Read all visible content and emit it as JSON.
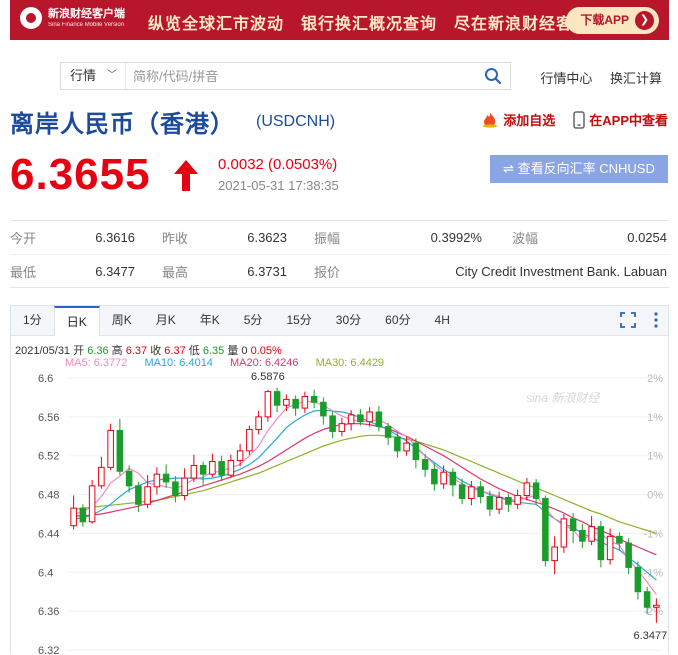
{
  "banner": {
    "logo_text": "新浪财经客户端",
    "logo_sub": "Sina Finance Mobile Version",
    "slogan": "纵览全球汇市波动　银行换汇概况查询　尽在新浪财经客户端",
    "download": "下载APP"
  },
  "search": {
    "category": "行情",
    "placeholder": "简称/代码/拼音",
    "links": [
      "行情中心",
      "换汇计算"
    ]
  },
  "header": {
    "title": "离岸人民币（香港）",
    "code": "(USDCNH)",
    "add_watch": "添加自选",
    "view_in_app": "在APP中查看"
  },
  "quote": {
    "price": "6.3655",
    "change": "0.0032 (0.0503%)",
    "time": "2021-05-31 17:38:35",
    "reverse_btn": "⇌ 查看反向汇率 CNHUSD"
  },
  "stats": {
    "row1": [
      {
        "label": "今开",
        "value": "6.3616"
      },
      {
        "label": "昨收",
        "value": "6.3623"
      },
      {
        "label": "振幅",
        "value": "0.3992%"
      },
      {
        "label": "波幅",
        "value": "0.0254"
      }
    ],
    "row2": [
      {
        "label": "最低",
        "value": "6.3477"
      },
      {
        "label": "最高",
        "value": "6.3731"
      },
      {
        "label": "报价",
        "value": "City Credit Investment Bank. Labuan"
      }
    ]
  },
  "tabs": [
    "1分",
    "日K",
    "周K",
    "月K",
    "年K",
    "5分",
    "15分",
    "30分",
    "60分",
    "4H"
  ],
  "active_tab": "日K",
  "kline_info": {
    "date": "2021/05/31",
    "open_label": "开",
    "open": "6.36",
    "high_label": "高",
    "high": "6.37",
    "close_label": "收",
    "close": "6.37",
    "low_label": "低",
    "low": "6.35",
    "vol_label": "量",
    "vol": "0",
    "pct": "0.05%"
  },
  "ma": [
    {
      "label": "MA5: 6.3772",
      "color": "#f08cc0"
    },
    {
      "label": "MA10: 6.4014",
      "color": "#2aa8d8"
    },
    {
      "label": "MA20: 6.4246",
      "color": "#e0356d"
    },
    {
      "label": "MA30: 6.4429",
      "color": "#8db227"
    }
  ],
  "watermark": "sina 新浪财经",
  "chart_data": {
    "type": "candlestick",
    "ylim": [
      6.32,
      6.6
    ],
    "y_ticks": [
      "6.6",
      "6.56",
      "6.52",
      "6.48",
      "6.44",
      "6.4",
      "6.36",
      "6.32"
    ],
    "right_ticks": [
      "2%",
      "1%",
      "1%",
      "0%",
      "-1%",
      "-1%",
      "-2%"
    ],
    "max_label": "6.5876",
    "min_label": "6.3477",
    "up_color": "#e60012",
    "down_color": "#1a9d2a",
    "candles": [
      [
        6.448,
        6.466,
        6.479,
        6.444
      ],
      [
        6.466,
        6.452,
        6.47,
        6.447
      ],
      [
        6.452,
        6.489,
        6.495,
        6.45
      ],
      [
        6.489,
        6.508,
        6.519,
        6.486
      ],
      [
        6.508,
        6.546,
        6.553,
        6.505
      ],
      [
        6.546,
        6.504,
        6.558,
        6.5
      ],
      [
        6.504,
        6.489,
        6.51,
        6.482
      ],
      [
        6.489,
        6.47,
        6.493,
        6.462
      ],
      [
        6.47,
        6.488,
        6.5,
        6.466
      ],
      [
        6.488,
        6.501,
        6.508,
        6.48
      ],
      [
        6.501,
        6.493,
        6.511,
        6.487
      ],
      [
        6.493,
        6.479,
        6.499,
        6.472
      ],
      [
        6.479,
        6.497,
        6.507,
        6.474
      ],
      [
        6.497,
        6.51,
        6.521,
        6.493
      ],
      [
        6.51,
        6.501,
        6.514,
        6.49
      ],
      [
        6.501,
        6.514,
        6.522,
        6.498
      ],
      [
        6.514,
        6.5,
        6.52,
        6.494
      ],
      [
        6.5,
        6.515,
        6.521,
        6.497
      ],
      [
        6.515,
        6.525,
        6.532,
        6.509
      ],
      [
        6.525,
        6.547,
        6.551,
        6.521
      ],
      [
        6.547,
        6.56,
        6.566,
        6.542
      ],
      [
        6.56,
        6.586,
        6.588,
        6.555
      ],
      [
        6.586,
        6.572,
        6.59,
        6.565
      ],
      [
        6.572,
        6.578,
        6.583,
        6.566
      ],
      [
        6.578,
        6.569,
        6.582,
        6.561
      ],
      [
        6.569,
        6.581,
        6.586,
        6.564
      ],
      [
        6.581,
        6.575,
        6.588,
        6.569
      ],
      [
        6.575,
        6.561,
        6.58,
        6.552
      ],
      [
        6.561,
        6.545,
        6.566,
        6.538
      ],
      [
        6.545,
        6.553,
        6.559,
        6.54
      ],
      [
        6.553,
        6.562,
        6.567,
        6.546
      ],
      [
        6.562,
        6.555,
        6.568,
        6.551
      ],
      [
        6.555,
        6.565,
        6.57,
        6.55
      ],
      [
        6.565,
        6.55,
        6.571,
        6.545
      ],
      [
        6.55,
        6.539,
        6.554,
        6.531
      ],
      [
        6.539,
        6.525,
        6.545,
        6.518
      ],
      [
        6.525,
        6.533,
        6.54,
        6.52
      ],
      [
        6.533,
        6.516,
        6.538,
        6.507
      ],
      [
        6.516,
        6.506,
        6.522,
        6.498
      ],
      [
        6.506,
        6.491,
        6.512,
        6.484
      ],
      [
        6.491,
        6.503,
        6.51,
        6.486
      ],
      [
        6.503,
        6.49,
        6.507,
        6.478
      ],
      [
        6.49,
        6.476,
        6.496,
        6.47
      ],
      [
        6.476,
        6.488,
        6.494,
        6.469
      ],
      [
        6.488,
        6.478,
        6.494,
        6.471
      ],
      [
        6.478,
        6.465,
        6.484,
        6.458
      ],
      [
        6.465,
        6.477,
        6.483,
        6.46
      ],
      [
        6.477,
        6.47,
        6.481,
        6.462
      ],
      [
        6.47,
        6.479,
        6.485,
        6.465
      ],
      [
        6.479,
        6.492,
        6.497,
        6.474
      ],
      [
        6.492,
        6.476,
        6.496,
        6.469
      ],
      [
        6.476,
        6.412,
        6.479,
        6.406
      ],
      [
        6.412,
        6.426,
        6.437,
        6.398
      ],
      [
        6.426,
        6.455,
        6.46,
        6.42
      ],
      [
        6.455,
        6.443,
        6.461,
        6.43
      ],
      [
        6.443,
        6.432,
        6.45,
        6.425
      ],
      [
        6.432,
        6.447,
        6.458,
        6.428
      ],
      [
        6.447,
        6.413,
        6.453,
        6.405
      ],
      [
        6.413,
        6.437,
        6.445,
        6.408
      ],
      [
        6.437,
        6.43,
        6.441,
        6.422
      ],
      [
        6.43,
        6.405,
        6.435,
        6.398
      ],
      [
        6.405,
        6.38,
        6.411,
        6.372
      ],
      [
        6.38,
        6.364,
        6.385,
        6.357
      ],
      [
        6.364,
        6.366,
        6.373,
        6.348
      ]
    ],
    "ma5": [
      6.46,
      6.462,
      6.468,
      6.478,
      6.492,
      6.499,
      6.507,
      6.502,
      6.492,
      6.49,
      6.488,
      6.486,
      6.49,
      6.496,
      6.498,
      6.503,
      6.504,
      6.508,
      6.511,
      6.52,
      6.53,
      6.546,
      6.558,
      6.569,
      6.573,
      6.576,
      6.575,
      6.572,
      6.566,
      6.561,
      6.557,
      6.555,
      6.556,
      6.557,
      6.552,
      6.545,
      6.54,
      6.53,
      6.52,
      6.511,
      6.503,
      6.497,
      6.491,
      6.486,
      6.484,
      6.481,
      6.478,
      6.475,
      6.474,
      6.477,
      6.479,
      6.466,
      6.455,
      6.448,
      6.444,
      6.432,
      6.441,
      6.44,
      6.432,
      6.428,
      6.413,
      6.402,
      6.39,
      6.377
    ],
    "ma10": [
      6.455,
      6.456,
      6.459,
      6.464,
      6.47,
      6.478,
      6.485,
      6.489,
      6.493,
      6.495,
      6.496,
      6.497,
      6.497,
      6.497,
      6.496,
      6.497,
      6.499,
      6.502,
      6.506,
      6.511,
      6.518,
      6.528,
      6.538,
      6.549,
      6.556,
      6.562,
      6.566,
      6.567,
      6.566,
      6.565,
      6.563,
      6.559,
      6.555,
      6.551,
      6.547,
      6.541,
      6.535,
      6.528,
      6.52,
      6.513,
      6.506,
      6.5,
      6.494,
      6.489,
      6.484,
      6.48,
      6.477,
      6.474,
      6.472,
      6.471,
      6.47,
      6.462,
      6.455,
      6.45,
      6.446,
      6.44,
      6.436,
      6.431,
      6.427,
      6.423,
      6.415,
      6.408,
      6.4,
      6.392
    ],
    "ma20": [
      6.458,
      6.458,
      6.459,
      6.46,
      6.462,
      6.464,
      6.466,
      6.468,
      6.471,
      6.474,
      6.477,
      6.48,
      6.483,
      6.486,
      6.489,
      6.492,
      6.495,
      6.498,
      6.501,
      6.505,
      6.509,
      6.514,
      6.52,
      6.526,
      6.532,
      6.538,
      6.543,
      6.547,
      6.55,
      6.552,
      6.553,
      6.553,
      6.552,
      6.55,
      6.548,
      6.544,
      6.54,
      6.535,
      6.53,
      6.525,
      6.52,
      6.514,
      6.508,
      6.502,
      6.496,
      6.491,
      6.486,
      6.482,
      6.478,
      6.475,
      6.472,
      6.469,
      6.465,
      6.461,
      6.456,
      6.452,
      6.447,
      6.443,
      6.439,
      6.434,
      6.43,
      6.426,
      6.422,
      6.418
    ],
    "ma30": [
      6.465,
      6.466,
      6.467,
      6.468,
      6.469,
      6.47,
      6.471,
      6.472,
      6.473,
      6.474,
      6.476,
      6.478,
      6.48,
      6.482,
      6.484,
      6.487,
      6.49,
      6.493,
      6.496,
      6.499,
      6.502,
      6.506,
      6.51,
      6.514,
      6.518,
      6.522,
      6.526,
      6.53,
      6.533,
      6.536,
      6.538,
      6.54,
      6.541,
      6.541,
      6.54,
      6.539,
      6.537,
      6.535,
      6.532,
      6.529,
      6.526,
      6.522,
      6.518,
      6.514,
      6.51,
      6.506,
      6.502,
      6.498,
      6.494,
      6.49,
      6.487,
      6.483,
      6.479,
      6.475,
      6.471,
      6.467,
      6.463,
      6.46,
      6.456,
      6.452,
      6.449,
      6.446,
      6.443,
      6.44
    ]
  }
}
